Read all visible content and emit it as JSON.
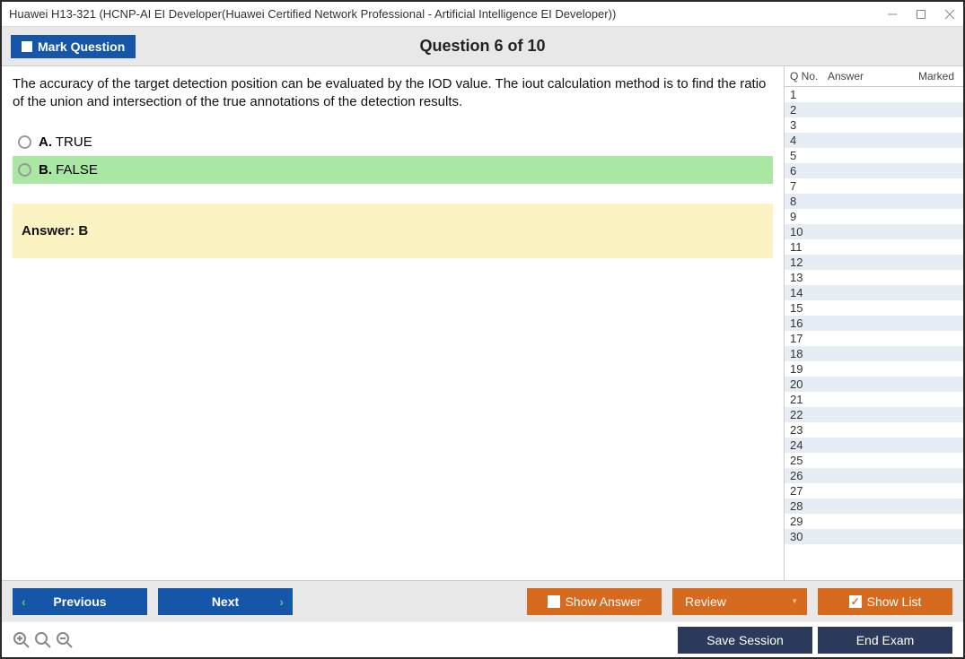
{
  "titlebar": "Huawei H13-321 (HCNP-AI EI Developer(Huawei Certified Network Professional - Artificial Intelligence EI Developer))",
  "header": {
    "mark_label": "Mark Question",
    "question_title": "Question 6 of 10"
  },
  "question": {
    "text": "The accuracy of the target detection position can be evaluated by the IOD value. The iout calculation method is to find the ratio of the union and intersection of the true annotations of the detection results.",
    "options": [
      {
        "letter": "A.",
        "text": "TRUE",
        "correct": false
      },
      {
        "letter": "B.",
        "text": "FALSE",
        "correct": true
      }
    ],
    "answer_label": "Answer: B"
  },
  "side": {
    "col_qno": "Q No.",
    "col_answer": "Answer",
    "col_marked": "Marked",
    "row_count": 30
  },
  "footer": {
    "previous": "Previous",
    "next": "Next",
    "show_answer": "Show Answer",
    "review": "Review",
    "show_list": "Show List",
    "save_session": "Save Session",
    "end_exam": "End Exam"
  }
}
